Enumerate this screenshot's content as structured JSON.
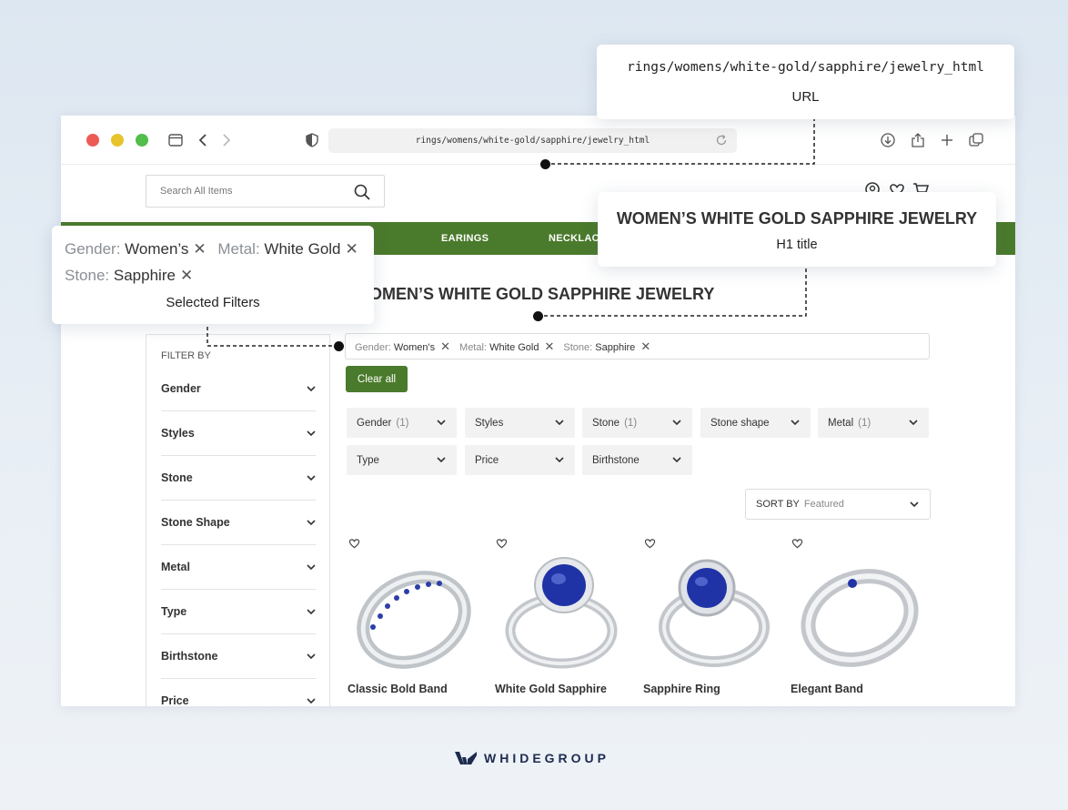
{
  "browser": {
    "address": "rings/womens/white-gold/sapphire/jewelry_html",
    "traffic_colors": [
      "#ec5b56",
      "#e7c32c",
      "#53be4a"
    ]
  },
  "site": {
    "search_placeholder": "Search All Items",
    "nav": [
      "EARINGS",
      "NECKLACE"
    ],
    "accent": "#4a7a2b",
    "page_title": "WOMEN’S WHITE GOLD SAPPHIRE JEWELRY"
  },
  "sidebar": {
    "heading": "FILTER BY",
    "items": [
      "Gender",
      "Styles",
      "Stone",
      "Stone Shape",
      "Metal",
      "Type",
      "Birthstone",
      "Price"
    ]
  },
  "selected_filters": [
    {
      "key": "Gender:",
      "value": "Women's"
    },
    {
      "key": "Metal:",
      "value": "White Gold"
    },
    {
      "key": "Stone:",
      "value": "Sapphire"
    }
  ],
  "clear_all": "Clear all",
  "filter_dropdowns": [
    {
      "label": "Gender",
      "count": "(1)"
    },
    {
      "label": "Styles",
      "count": ""
    },
    {
      "label": "Stone",
      "count": "(1)"
    },
    {
      "label": "Stone shape",
      "count": ""
    },
    {
      "label": "Metal",
      "count": "(1)"
    },
    {
      "label": "Type",
      "count": ""
    },
    {
      "label": "Price",
      "count": ""
    },
    {
      "label": "Birthstone",
      "count": ""
    }
  ],
  "sort": {
    "label": "SORT BY",
    "value": "Featured"
  },
  "products": [
    {
      "name": "Classic Bold Band"
    },
    {
      "name": "White Gold Sapphire"
    },
    {
      "name": "Sapphire Ring"
    },
    {
      "name": "Elegant Band"
    }
  ],
  "callouts": {
    "url": {
      "value": "rings/womens/white-gold/sapphire/jewelry_html",
      "caption": "URL"
    },
    "h1": {
      "value": "WOMEN’S WHITE GOLD SAPPHIRE JEWELRY",
      "caption": "H1 title"
    },
    "filters": {
      "items": [
        {
          "key": "Gender:",
          "value": "Women’s"
        },
        {
          "key": "Metal:",
          "value": "White Gold"
        },
        {
          "key": "Stone:",
          "value": "Sapphire"
        }
      ],
      "caption": "Selected Filters"
    }
  },
  "brand": "WHIDEGROUP"
}
